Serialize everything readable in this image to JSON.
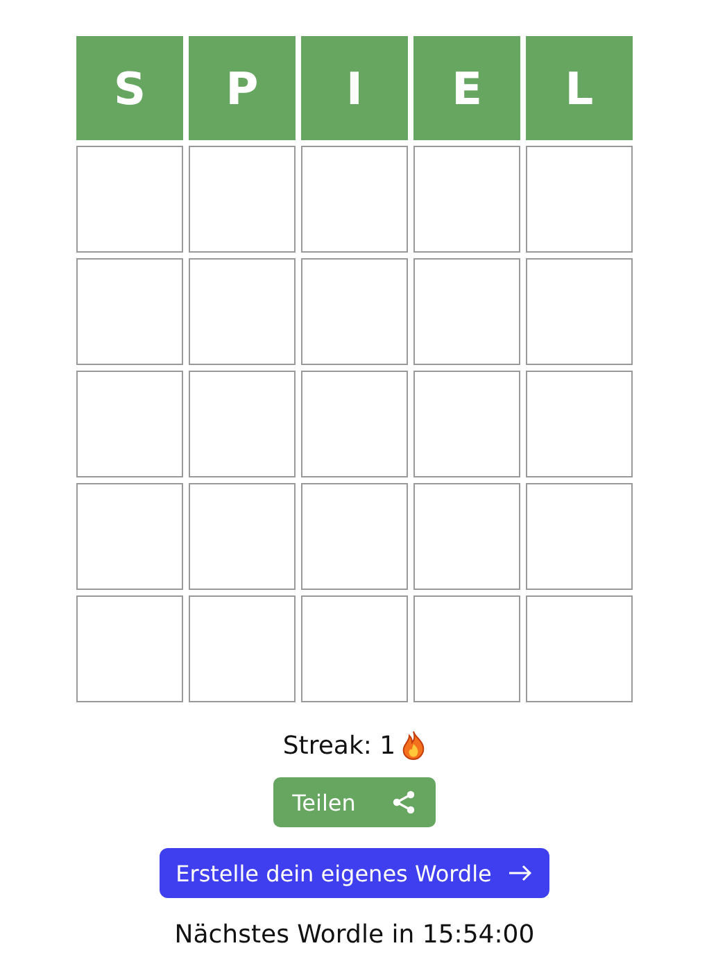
{
  "board": {
    "rows": [
      {
        "tiles": [
          {
            "letter": "S",
            "kind": "correct"
          },
          {
            "letter": "P",
            "kind": "correct"
          },
          {
            "letter": "I",
            "kind": "correct"
          },
          {
            "letter": "E",
            "kind": "correct"
          },
          {
            "letter": "L",
            "kind": "correct"
          }
        ]
      },
      {
        "tiles": [
          {
            "kind": "empty"
          },
          {
            "kind": "empty"
          },
          {
            "kind": "empty"
          },
          {
            "kind": "empty"
          },
          {
            "kind": "empty"
          }
        ]
      },
      {
        "tiles": [
          {
            "kind": "empty"
          },
          {
            "kind": "empty"
          },
          {
            "kind": "empty"
          },
          {
            "kind": "empty"
          },
          {
            "kind": "empty"
          }
        ]
      },
      {
        "tiles": [
          {
            "kind": "empty"
          },
          {
            "kind": "empty"
          },
          {
            "kind": "empty"
          },
          {
            "kind": "empty"
          },
          {
            "kind": "empty"
          }
        ]
      },
      {
        "tiles": [
          {
            "kind": "empty"
          },
          {
            "kind": "empty"
          },
          {
            "kind": "empty"
          },
          {
            "kind": "empty"
          },
          {
            "kind": "empty"
          }
        ]
      },
      {
        "tiles": [
          {
            "kind": "empty"
          },
          {
            "kind": "empty"
          },
          {
            "kind": "empty"
          },
          {
            "kind": "empty"
          },
          {
            "kind": "empty"
          }
        ]
      }
    ]
  },
  "streak": {
    "label": "Streak: 1"
  },
  "share_button": {
    "label": "Teilen"
  },
  "create_button": {
    "label": "Erstelle dein eigenes Wordle"
  },
  "next_wordle": "Nächstes Wordle in 15:54:00"
}
